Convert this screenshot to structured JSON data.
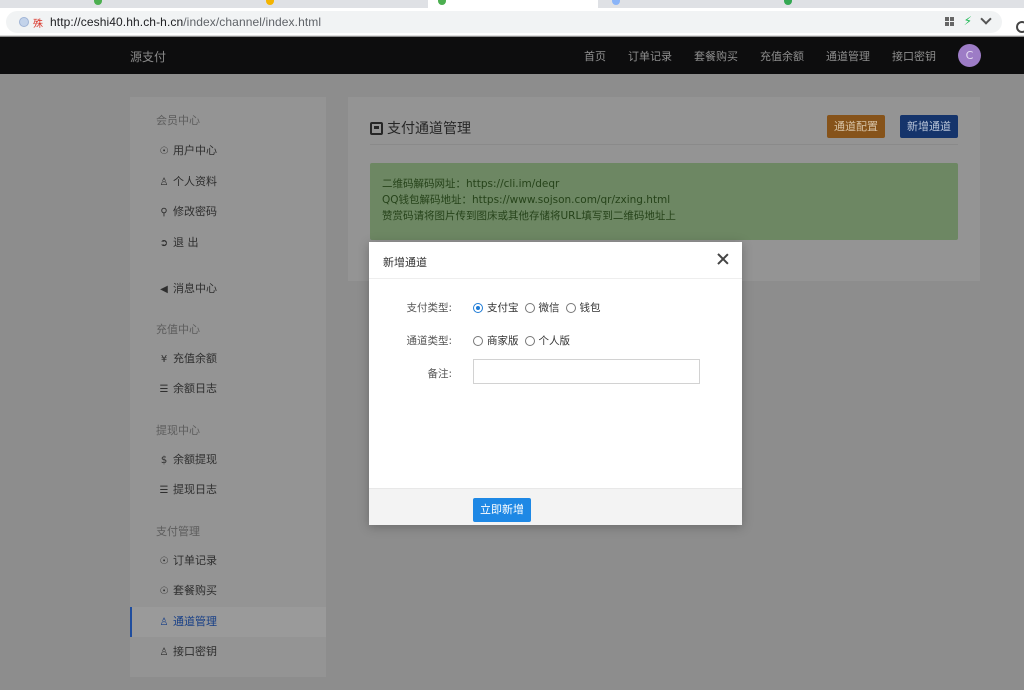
{
  "browser": {
    "insecure_label": "殊",
    "url_host": "http://ceshi40.hh.ch-h.cn",
    "url_path": "/index/channel/index.html"
  },
  "header": {
    "brand": "源支付",
    "nav": [
      "首页",
      "订单记录",
      "套餐购买",
      "充值余额",
      "通道管理",
      "接口密钥"
    ],
    "avatar_letter": "C"
  },
  "sidebar": {
    "groups": [
      {
        "label": "会员中心"
      },
      {
        "label": "充值中心"
      },
      {
        "label": "提现中心"
      },
      {
        "label": "支付管理"
      }
    ],
    "items": [
      {
        "label": "用户中心",
        "icon": "user-circle-icon"
      },
      {
        "label": "个人资料",
        "icon": "user-icon"
      },
      {
        "label": "修改密码",
        "icon": "key-icon"
      },
      {
        "label": "退 出",
        "icon": "logout-icon"
      },
      {
        "label": "消息中心",
        "icon": "bullhorn-icon"
      },
      {
        "label": "充值余额",
        "icon": "yen-icon"
      },
      {
        "label": "余额日志",
        "icon": "list-icon"
      },
      {
        "label": "余额提现",
        "icon": "dollar-icon"
      },
      {
        "label": "提现日志",
        "icon": "list-icon"
      },
      {
        "label": "订单记录",
        "icon": "user-circle-icon"
      },
      {
        "label": "套餐购买",
        "icon": "user-circle-icon"
      },
      {
        "label": "通道管理",
        "icon": "user-icon"
      },
      {
        "label": "接口密钥",
        "icon": "user-icon"
      }
    ]
  },
  "main": {
    "title": "支付通道管理",
    "config_button": "通道配置",
    "new_button": "新增通道",
    "notice_lines": [
      "二维码解码网址：https://cli.im/deqr",
      "QQ钱包解码地址：https://www.sojson.com/qr/zxing.html",
      "赞赏码请将图片传到图床或其他存储将URL填写到二维码地址上"
    ]
  },
  "modal": {
    "title": "新增通道",
    "pay_type_label": "支付类型:",
    "pay_type_options": [
      "支付宝",
      "微信",
      "钱包"
    ],
    "pay_type_selected": "支付宝",
    "channel_type_label": "通道类型:",
    "channel_type_options": [
      "商家版",
      "个人版"
    ],
    "remark_label": "备注:",
    "remark_value": "",
    "submit_label": "立即新增"
  },
  "colors": {
    "accent": "#1e88e5",
    "warning_button": "#86531a",
    "primary_button": "#15346b",
    "notice_bg": "#6d8763"
  }
}
